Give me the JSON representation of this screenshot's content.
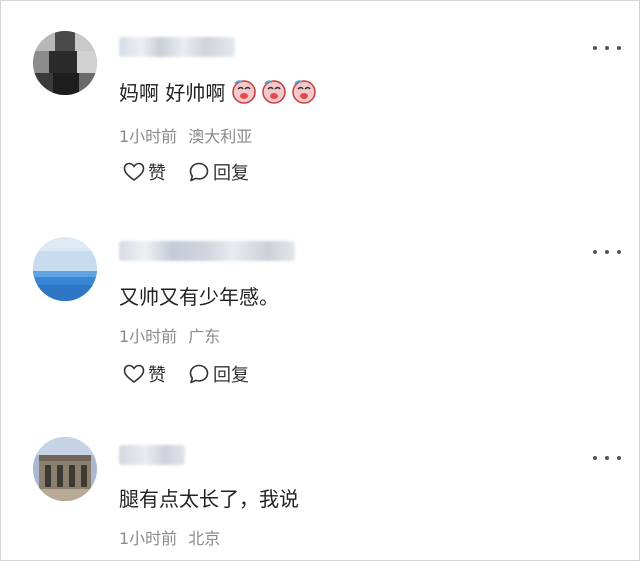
{
  "comments": [
    {
      "text": "妈啊  好帅啊",
      "emoji_count": 3,
      "emoji_icon": "crying-face-emoji",
      "time": "1小时前",
      "location": "澳大利亚",
      "like_label": "赞",
      "reply_label": "回复"
    },
    {
      "text": "又帅又有少年感。",
      "time": "1小时前",
      "location": "广东",
      "like_label": "赞",
      "reply_label": "回复"
    },
    {
      "text": "腿有点太长了，我说",
      "time": "1小时前",
      "location": "北京"
    }
  ],
  "icons": {
    "like": "heart-icon",
    "reply": "speech-bubble-icon",
    "more": "more-dots-icon"
  },
  "colors": {
    "meta_text": "#8a8a8a",
    "body_text": "#222222",
    "emoji_red": "#e24b4b"
  }
}
